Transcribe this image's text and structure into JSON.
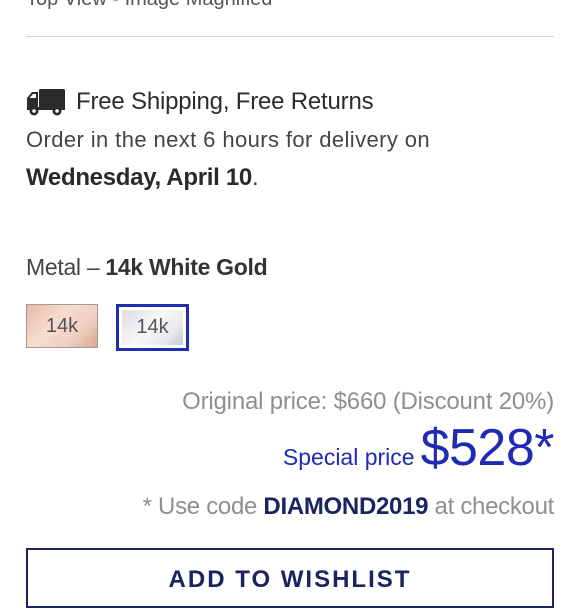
{
  "top_cut_text": "Top View - Image Magnified",
  "shipping": {
    "icon": "truck-icon",
    "title": "Free Shipping, Free Returns",
    "delivery_line": "Order in the next 6 hours for delivery on",
    "delivery_date": "Wednesday, April 10",
    "delivery_period": "."
  },
  "metal": {
    "label_prefix": "Metal – ",
    "selected": "14k White Gold",
    "options": [
      {
        "label": "14k",
        "color": "#f0d0c2",
        "selected": false
      },
      {
        "label": "14k",
        "color": "#ecedf0",
        "selected": true
      }
    ],
    "selected_border_color": "#1f2fb0"
  },
  "pricing": {
    "original_price_text": "Original price: $660 (Discount 20%)",
    "special_label": "Special price",
    "special_value": "$528*",
    "code_prefix": "* Use code",
    "code": "DIAMOND2019",
    "code_suffix": "at checkout",
    "accent_color": "#1e2bb2"
  },
  "wishlist_button": {
    "label": "ADD TO WISHLIST"
  }
}
